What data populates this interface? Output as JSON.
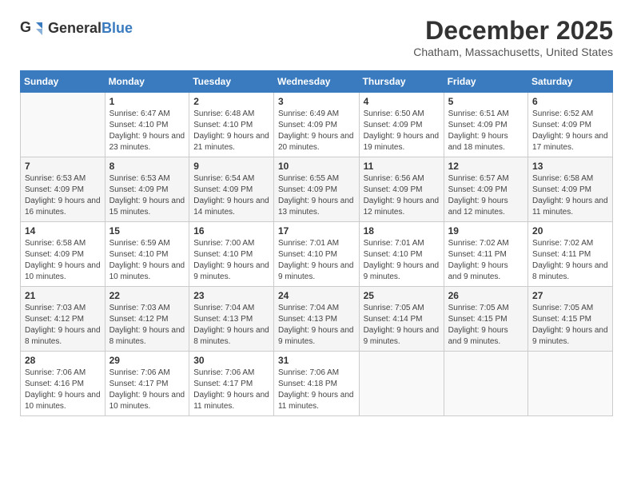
{
  "header": {
    "logo_general": "General",
    "logo_blue": "Blue",
    "month_year": "December 2025",
    "location": "Chatham, Massachusetts, United States"
  },
  "columns": [
    "Sunday",
    "Monday",
    "Tuesday",
    "Wednesday",
    "Thursday",
    "Friday",
    "Saturday"
  ],
  "weeks": [
    [
      {
        "day": "",
        "sunrise": "",
        "sunset": "",
        "daylight": ""
      },
      {
        "day": "1",
        "sunrise": "Sunrise: 6:47 AM",
        "sunset": "Sunset: 4:10 PM",
        "daylight": "Daylight: 9 hours and 23 minutes."
      },
      {
        "day": "2",
        "sunrise": "Sunrise: 6:48 AM",
        "sunset": "Sunset: 4:10 PM",
        "daylight": "Daylight: 9 hours and 21 minutes."
      },
      {
        "day": "3",
        "sunrise": "Sunrise: 6:49 AM",
        "sunset": "Sunset: 4:09 PM",
        "daylight": "Daylight: 9 hours and 20 minutes."
      },
      {
        "day": "4",
        "sunrise": "Sunrise: 6:50 AM",
        "sunset": "Sunset: 4:09 PM",
        "daylight": "Daylight: 9 hours and 19 minutes."
      },
      {
        "day": "5",
        "sunrise": "Sunrise: 6:51 AM",
        "sunset": "Sunset: 4:09 PM",
        "daylight": "Daylight: 9 hours and 18 minutes."
      },
      {
        "day": "6",
        "sunrise": "Sunrise: 6:52 AM",
        "sunset": "Sunset: 4:09 PM",
        "daylight": "Daylight: 9 hours and 17 minutes."
      }
    ],
    [
      {
        "day": "7",
        "sunrise": "Sunrise: 6:53 AM",
        "sunset": "Sunset: 4:09 PM",
        "daylight": "Daylight: 9 hours and 16 minutes."
      },
      {
        "day": "8",
        "sunrise": "Sunrise: 6:53 AM",
        "sunset": "Sunset: 4:09 PM",
        "daylight": "Daylight: 9 hours and 15 minutes."
      },
      {
        "day": "9",
        "sunrise": "Sunrise: 6:54 AM",
        "sunset": "Sunset: 4:09 PM",
        "daylight": "Daylight: 9 hours and 14 minutes."
      },
      {
        "day": "10",
        "sunrise": "Sunrise: 6:55 AM",
        "sunset": "Sunset: 4:09 PM",
        "daylight": "Daylight: 9 hours and 13 minutes."
      },
      {
        "day": "11",
        "sunrise": "Sunrise: 6:56 AM",
        "sunset": "Sunset: 4:09 PM",
        "daylight": "Daylight: 9 hours and 12 minutes."
      },
      {
        "day": "12",
        "sunrise": "Sunrise: 6:57 AM",
        "sunset": "Sunset: 4:09 PM",
        "daylight": "Daylight: 9 hours and 12 minutes."
      },
      {
        "day": "13",
        "sunrise": "Sunrise: 6:58 AM",
        "sunset": "Sunset: 4:09 PM",
        "daylight": "Daylight: 9 hours and 11 minutes."
      }
    ],
    [
      {
        "day": "14",
        "sunrise": "Sunrise: 6:58 AM",
        "sunset": "Sunset: 4:09 PM",
        "daylight": "Daylight: 9 hours and 10 minutes."
      },
      {
        "day": "15",
        "sunrise": "Sunrise: 6:59 AM",
        "sunset": "Sunset: 4:10 PM",
        "daylight": "Daylight: 9 hours and 10 minutes."
      },
      {
        "day": "16",
        "sunrise": "Sunrise: 7:00 AM",
        "sunset": "Sunset: 4:10 PM",
        "daylight": "Daylight: 9 hours and 9 minutes."
      },
      {
        "day": "17",
        "sunrise": "Sunrise: 7:01 AM",
        "sunset": "Sunset: 4:10 PM",
        "daylight": "Daylight: 9 hours and 9 minutes."
      },
      {
        "day": "18",
        "sunrise": "Sunrise: 7:01 AM",
        "sunset": "Sunset: 4:10 PM",
        "daylight": "Daylight: 9 hours and 9 minutes."
      },
      {
        "day": "19",
        "sunrise": "Sunrise: 7:02 AM",
        "sunset": "Sunset: 4:11 PM",
        "daylight": "Daylight: 9 hours and 9 minutes."
      },
      {
        "day": "20",
        "sunrise": "Sunrise: 7:02 AM",
        "sunset": "Sunset: 4:11 PM",
        "daylight": "Daylight: 9 hours and 8 minutes."
      }
    ],
    [
      {
        "day": "21",
        "sunrise": "Sunrise: 7:03 AM",
        "sunset": "Sunset: 4:12 PM",
        "daylight": "Daylight: 9 hours and 8 minutes."
      },
      {
        "day": "22",
        "sunrise": "Sunrise: 7:03 AM",
        "sunset": "Sunset: 4:12 PM",
        "daylight": "Daylight: 9 hours and 8 minutes."
      },
      {
        "day": "23",
        "sunrise": "Sunrise: 7:04 AM",
        "sunset": "Sunset: 4:13 PM",
        "daylight": "Daylight: 9 hours and 8 minutes."
      },
      {
        "day": "24",
        "sunrise": "Sunrise: 7:04 AM",
        "sunset": "Sunset: 4:13 PM",
        "daylight": "Daylight: 9 hours and 9 minutes."
      },
      {
        "day": "25",
        "sunrise": "Sunrise: 7:05 AM",
        "sunset": "Sunset: 4:14 PM",
        "daylight": "Daylight: 9 hours and 9 minutes."
      },
      {
        "day": "26",
        "sunrise": "Sunrise: 7:05 AM",
        "sunset": "Sunset: 4:15 PM",
        "daylight": "Daylight: 9 hours and 9 minutes."
      },
      {
        "day": "27",
        "sunrise": "Sunrise: 7:05 AM",
        "sunset": "Sunset: 4:15 PM",
        "daylight": "Daylight: 9 hours and 9 minutes."
      }
    ],
    [
      {
        "day": "28",
        "sunrise": "Sunrise: 7:06 AM",
        "sunset": "Sunset: 4:16 PM",
        "daylight": "Daylight: 9 hours and 10 minutes."
      },
      {
        "day": "29",
        "sunrise": "Sunrise: 7:06 AM",
        "sunset": "Sunset: 4:17 PM",
        "daylight": "Daylight: 9 hours and 10 minutes."
      },
      {
        "day": "30",
        "sunrise": "Sunrise: 7:06 AM",
        "sunset": "Sunset: 4:17 PM",
        "daylight": "Daylight: 9 hours and 11 minutes."
      },
      {
        "day": "31",
        "sunrise": "Sunrise: 7:06 AM",
        "sunset": "Sunset: 4:18 PM",
        "daylight": "Daylight: 9 hours and 11 minutes."
      },
      {
        "day": "",
        "sunrise": "",
        "sunset": "",
        "daylight": ""
      },
      {
        "day": "",
        "sunrise": "",
        "sunset": "",
        "daylight": ""
      },
      {
        "day": "",
        "sunrise": "",
        "sunset": "",
        "daylight": ""
      }
    ]
  ]
}
